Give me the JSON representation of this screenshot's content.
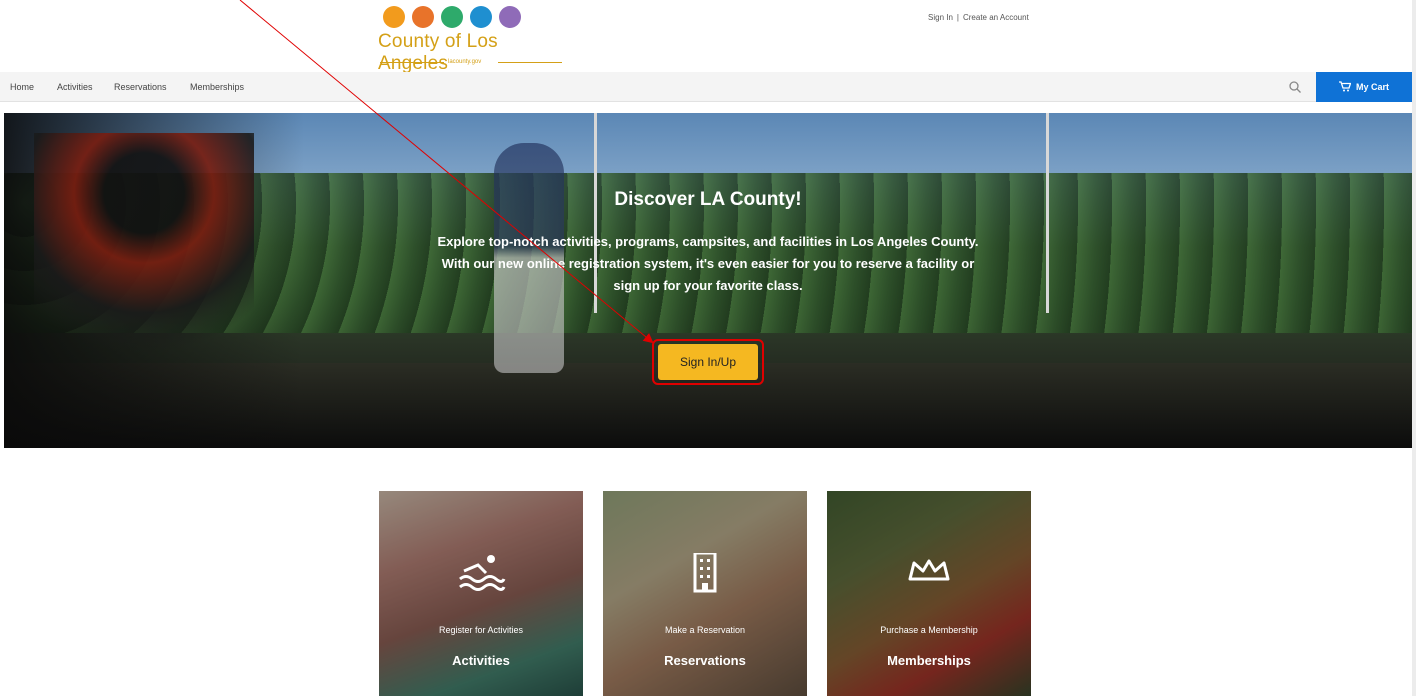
{
  "header": {
    "logo_text": "County of Los Angeles",
    "logo_sub": "lacounty.gov",
    "sign_in": "Sign In",
    "separator": "|",
    "create_account": "Create an Account",
    "logo_colors": [
      "#f29b1d",
      "#e8732a",
      "#2eaa6b",
      "#1f8fd0",
      "#8f6bb8"
    ]
  },
  "nav": {
    "items": [
      {
        "label": "Home"
      },
      {
        "label": "Activities"
      },
      {
        "label": "Reservations"
      },
      {
        "label": "Memberships"
      }
    ],
    "search_icon": "search-icon",
    "cart_label": "My Cart",
    "cart_icon": "cart-icon"
  },
  "hero": {
    "title": "Discover LA County!",
    "line1": "Explore top-notch activities, programs, campsites, and facilities in Los Angeles County.",
    "line2": "With our new online registration system, it's even easier for you to reserve a facility or",
    "line3": "sign up for your favorite class.",
    "cta_label": "Sign In/Up",
    "cta_color": "#f5b821",
    "highlight_color": "#e00000"
  },
  "cards": [
    {
      "subtitle": "Register for Activities",
      "title": "Activities",
      "icon": "swimmer-icon"
    },
    {
      "subtitle": "Make a Reservation",
      "title": "Reservations",
      "icon": "building-icon"
    },
    {
      "subtitle": "Purchase a Membership",
      "title": "Memberships",
      "icon": "crown-icon"
    }
  ],
  "colors": {
    "accent": "#0f72d6",
    "nav_bg": "#f4f4f4"
  }
}
